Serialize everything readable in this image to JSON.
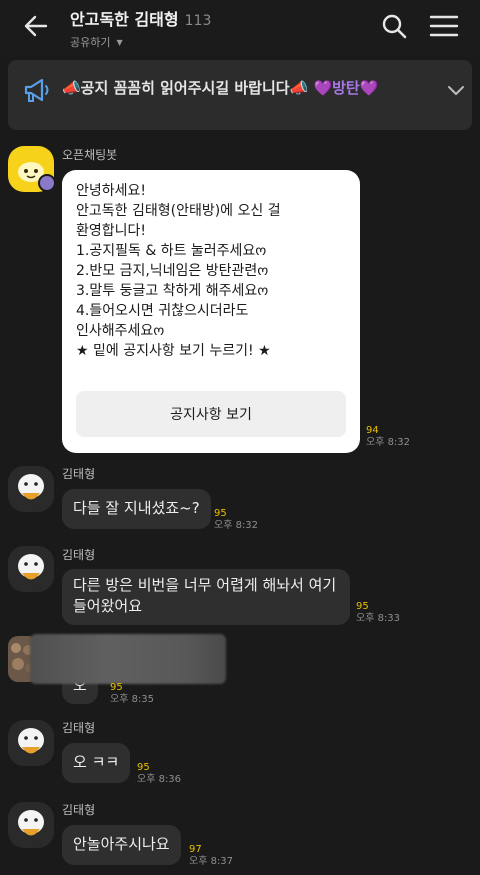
{
  "header": {
    "title": "안고독한 김태형",
    "member_count": "113",
    "share_label": "공유하기"
  },
  "notice": {
    "text_main": "📣공지 꼼꼼히 읽어주시길 바랍니다📣 ",
    "text_accent": "💜방탄💜"
  },
  "bot": {
    "name": "오픈채팅봇",
    "lines": [
      "안녕하세요!",
      "안고독한 김태형(안태방)에 오신 걸",
      "환영합니다!",
      "1.공지필독 & 하트 눌러주세요ო",
      "2.반모 금지,닉네임은 방탄관련ო",
      "3.말투 둥글고 착하게 해주세요ო",
      "4.들어오시면 귀찮으시더라도",
      "인사해주세요ო",
      "★ 밑에 공지사항 보기 누르기! ★"
    ],
    "button_label": "공지사항 보기",
    "unread": "94",
    "time": "오후 8:32"
  },
  "messages": [
    {
      "sender": "김태형",
      "text": "다들 잘 지내셨죠~?",
      "unread": "95",
      "time": "오후 8:32"
    },
    {
      "sender": "김태형",
      "lines": [
        "다른 방은 비번을 너무 어렵게 해놔서 여기",
        "들어왔어요"
      ],
      "unread": "95",
      "time": "오후 8:33"
    },
    {
      "sender": "",
      "text": "오",
      "unread": "95",
      "time": "오후 8:35"
    },
    {
      "sender": "김태형",
      "text": "오 ㅋㅋ",
      "unread": "95",
      "time": "오후 8:36"
    },
    {
      "sender": "김태형",
      "text": "안놀아주시나요",
      "unread": "97",
      "time": "오후 8:37"
    }
  ],
  "colors": {
    "background": "#1a1a1a",
    "bubble": "#2f2f2f",
    "unread": "#e8c100",
    "accent_purple": "#a779e8",
    "bot_avatar": "#f7d21b"
  }
}
